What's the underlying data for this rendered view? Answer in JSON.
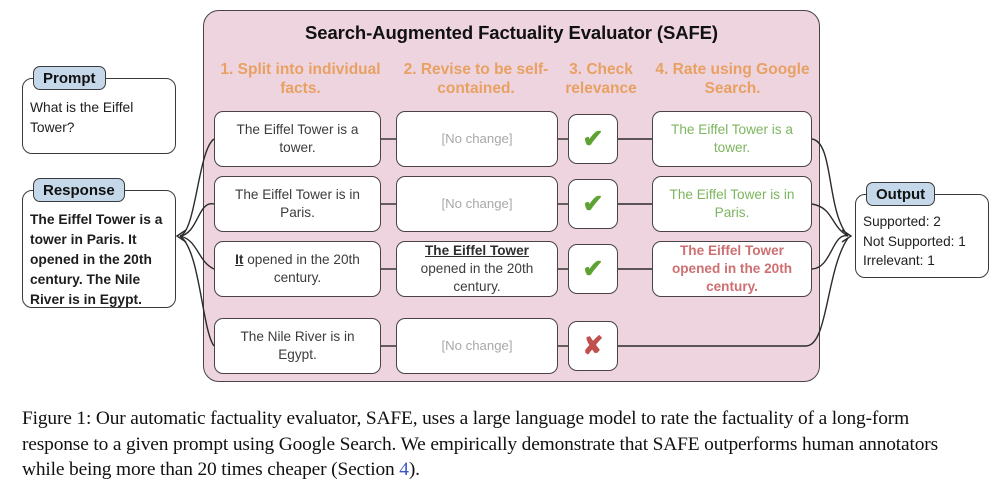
{
  "figure": {
    "panel_title": "Search-Augmented Factuality Evaluator (SAFE)",
    "panel_color": "#EDD4DE",
    "header_color": "#E8A163",
    "tab_color": "#C4D8EA",
    "supported_color": "#7CB55F",
    "unsupported_color": "#CE6F72",
    "check_color": "#5FA234",
    "cross_color": "#C0504D"
  },
  "steps": [
    {
      "id": "step-1",
      "label": "1. Split into individual facts."
    },
    {
      "id": "step-2",
      "label": "2. Revise to be self-contained."
    },
    {
      "id": "step-3",
      "label": "3. Check relevance"
    },
    {
      "id": "step-4",
      "label": "4. Rate using Google Search."
    }
  ],
  "prompt": {
    "tab_label": "Prompt",
    "text": "What is the Eiffel Tower?"
  },
  "response": {
    "tab_label": "Response",
    "text": "The Eiffel Tower is a tower in Paris. It opened in the 20th century. The Nile River is in Egypt."
  },
  "rows": [
    {
      "split_fact_prefix": "",
      "split_fact": "The Eiffel Tower is a tower.",
      "revised": "[No change]",
      "revised_is_placeholder": true,
      "revised_marked": "",
      "revised_rest": "",
      "relevance": "✔",
      "relevance_name": "check-icon",
      "rating": "The Eiffel Tower is a tower.",
      "rating_status": "supported"
    },
    {
      "split_fact_prefix": "",
      "split_fact": "The Eiffel Tower is in Paris.",
      "revised": "[No change]",
      "revised_is_placeholder": true,
      "revised_marked": "",
      "revised_rest": "",
      "relevance": "✔",
      "relevance_name": "check-icon",
      "rating": "The Eiffel Tower is in Paris.",
      "rating_status": "supported"
    },
    {
      "split_fact_prefix": "It",
      "split_fact": " opened in the 20th century.",
      "revised": "",
      "revised_is_placeholder": false,
      "revised_marked": "The Eiffel Tower",
      "revised_rest": " opened in the 20th century.",
      "relevance": "✔",
      "relevance_name": "check-icon",
      "rating": "The Eiffel Tower opened in the 20th century.",
      "rating_status": "not-supported"
    },
    {
      "split_fact_prefix": "",
      "split_fact": "The Nile River is in Egypt.",
      "revised": "[No change]",
      "revised_is_placeholder": true,
      "revised_marked": "",
      "revised_rest": "",
      "relevance": "✘",
      "relevance_name": "cross-icon",
      "rating": "",
      "rating_status": "none"
    }
  ],
  "output": {
    "tab_label": "Output",
    "lines": [
      "Supported: 2",
      "Not Supported: 1",
      "Irrelevant: 1"
    ]
  },
  "caption": {
    "part1": "Figure 1: Our automatic factuality evaluator, SAFE, uses a large language model to rate the factuality of a long-form response to a given prompt using Google Search. We empirically demonstrate that SAFE outperforms human annotators while being more than 20 times cheaper (Section ",
    "ref": "4",
    "part2": ")."
  }
}
